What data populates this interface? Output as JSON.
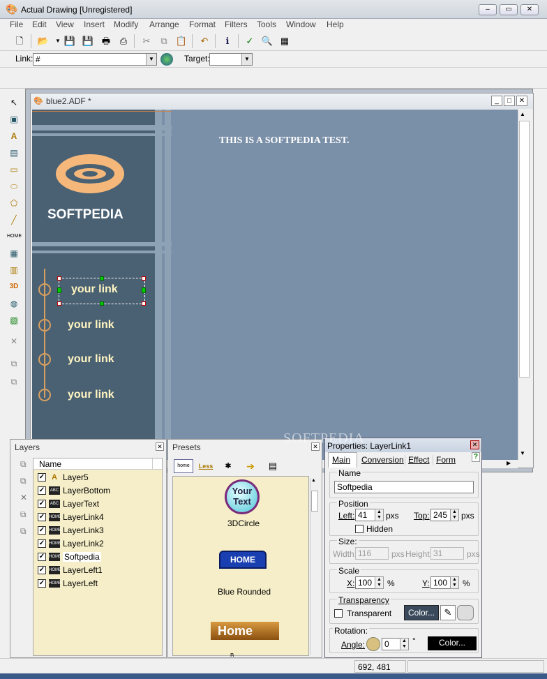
{
  "window": {
    "title": "Actual Drawing [Unregistered]",
    "minimize": "–",
    "restore": "▭",
    "close": "✕"
  },
  "menu": [
    "File",
    "Edit",
    "View",
    "Insert",
    "Modify",
    "Arrange",
    "Format",
    "Filters",
    "Tools",
    "Window",
    "Help"
  ],
  "linkbar": {
    "link_label": "Link:",
    "link_value": "#",
    "target_label": "Target:",
    "target_value": ""
  },
  "document": {
    "title": "blue2.ADF *",
    "heading_text": "THIS IS A SOFTPEDIA TEST.",
    "logo_text": "SOFTPEDIA",
    "links": [
      "your link",
      "your link",
      "your link",
      "your link"
    ]
  },
  "watermark": "SOFTPEDIA",
  "layers": {
    "title": "Layers",
    "column": "Name",
    "items": [
      {
        "name": "Layer5",
        "icon": "A"
      },
      {
        "name": "LayerBottom",
        "icon": "ABC"
      },
      {
        "name": "LayerText",
        "icon": "ABC"
      },
      {
        "name": "LayerLink4",
        "icon": "HOME"
      },
      {
        "name": "LayerLink3",
        "icon": "HOME"
      },
      {
        "name": "LayerLink2",
        "icon": "HOME"
      },
      {
        "name": "Softpedia",
        "icon": "HOME"
      },
      {
        "name": "LayerLeft1",
        "icon": "HOME"
      },
      {
        "name": "LayerLeft",
        "icon": "HOME"
      }
    ]
  },
  "presets": {
    "title": "Presets",
    "tab_home": "home",
    "tab_less": "Less",
    "items": [
      {
        "label": "3DCircle",
        "preview_line1": "Your",
        "preview_line2": "Text"
      },
      {
        "label": "Blue Rounded",
        "preview": "HOME"
      },
      {
        "label": "B...",
        "preview": "Home"
      }
    ]
  },
  "properties": {
    "title": "Properties: LayerLink1",
    "tabs": [
      "Main",
      "Conversion",
      "Effect",
      "Form"
    ],
    "help": "?",
    "name_label": "Name",
    "name_value": "Softpedia",
    "position_label": "Position",
    "left_label": "Left:",
    "left_value": "41",
    "top_label": "Top:",
    "top_value": "245",
    "pxs": "pxs",
    "hidden_label": "Hidden",
    "size_label": "Size:",
    "width_label": "Width:",
    "width_value": "116",
    "height_label": "Height:",
    "height_value": "31",
    "scale_label": "Scale",
    "x_label": "X:",
    "x_value": "100",
    "y_label": "Y:",
    "y_value": "100",
    "percent": "%",
    "transparency_label": "Transparency",
    "transparent_label": "Transparent",
    "color_btn": "Color...",
    "rotation_label": "Rotation:",
    "angle_label": "Angle:",
    "angle_value": "0",
    "degree": "°",
    "rot_color_btn": "Color..."
  },
  "status": {
    "coords": "692, 481"
  }
}
